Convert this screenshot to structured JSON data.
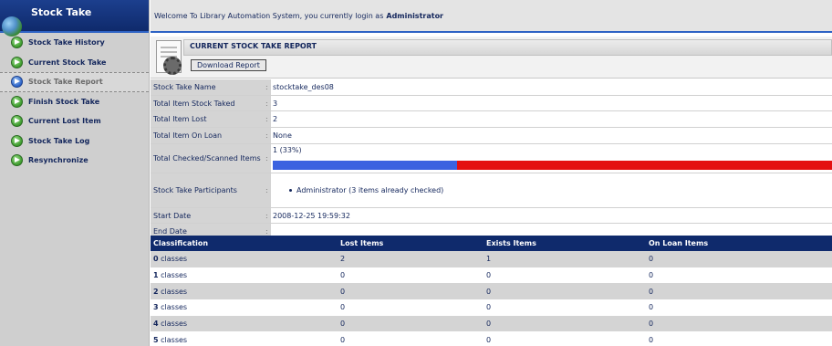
{
  "sidebar": {
    "title": "Stock Take",
    "items": [
      {
        "label": "Stock Take History"
      },
      {
        "label": "Current Stock Take"
      },
      {
        "label": "Stock Take Report"
      },
      {
        "label": "Finish Stock Take"
      },
      {
        "label": "Current Lost Item"
      },
      {
        "label": "Stock Take Log"
      },
      {
        "label": "Resynchronize"
      }
    ]
  },
  "topbar": {
    "welcome": "Welcome To Library Automation System, you currently login as",
    "user": "Administrator"
  },
  "report": {
    "title": "CURRENT STOCK TAKE REPORT",
    "download_label": "Download Report"
  },
  "info": {
    "name_label": "Stock Take Name",
    "name_value": "stocktake_des08",
    "taked_label": "Total Item Stock Taked",
    "taked_value": "3",
    "lost_label": "Total Item Lost",
    "lost_value": "2",
    "loan_label": "Total Item On Loan",
    "loan_value": "None",
    "checked_label": "Total Checked/Scanned Items",
    "checked_value": "1 (33%)",
    "checked_progress": 0.33,
    "participants_label": "Stock Take Participants",
    "participants_value": "Administrator (3 items already checked)",
    "start_label": "Start Date",
    "start_value": "2008-12-25 19:59:32",
    "end_label": "End Date",
    "end_value": "",
    "sep": ":"
  },
  "classification": {
    "headers": [
      "Classification",
      "Lost Items",
      "Exists Items",
      "On Loan Items"
    ],
    "rows": [
      {
        "num": "0",
        "suffix": " classes",
        "lost": "2",
        "exists": "1",
        "loan": "0"
      },
      {
        "num": "1",
        "suffix": " classes",
        "lost": "0",
        "exists": "0",
        "loan": "0"
      },
      {
        "num": "2",
        "suffix": " classes",
        "lost": "0",
        "exists": "0",
        "loan": "0"
      },
      {
        "num": "3",
        "suffix": " classes",
        "lost": "0",
        "exists": "0",
        "loan": "0"
      },
      {
        "num": "4",
        "suffix": " classes",
        "lost": "0",
        "exists": "0",
        "loan": "0"
      },
      {
        "num": "5",
        "suffix": " classes",
        "lost": "0",
        "exists": "0",
        "loan": "0"
      }
    ]
  },
  "colors": {
    "header_navy": "#0f2a6c",
    "progress_blue": "#3b62e0",
    "progress_red": "#e41010"
  }
}
